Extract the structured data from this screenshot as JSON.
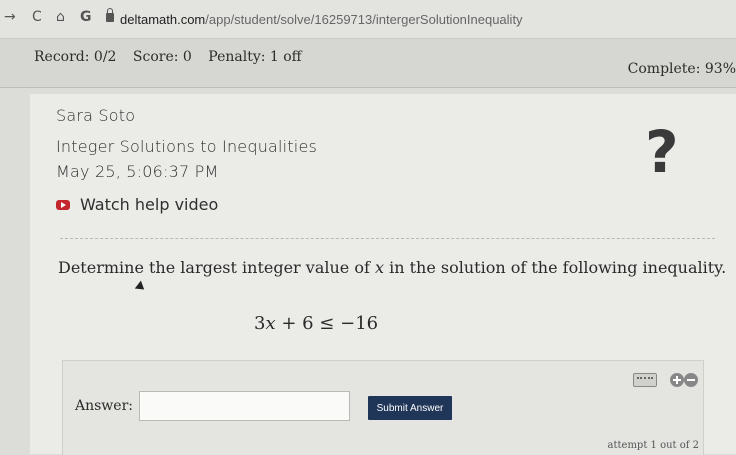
{
  "browser": {
    "url_host": "deltamath.com",
    "url_path": "/app/student/solve/16259713/intergerSolutionInequality"
  },
  "record_bar": {
    "record": "Record: 0/2",
    "score": "Score: 0",
    "penalty": "Penalty: 1 off",
    "complete": "Complete: 93%"
  },
  "header": {
    "student_name": "Sara Soto",
    "assignment": "Integer Solutions to Inequalities",
    "timestamp": "May 25, 5:06:37 PM",
    "help_mark": "?",
    "video_link": "Watch help video"
  },
  "problem": {
    "prompt_start": "Determine the largest integer value of ",
    "prompt_var": "x",
    "prompt_end": " in the solution of the following inequality.",
    "eq_coef": "3",
    "eq_var": "x",
    "eq_rest": " + 6 ≤ −16"
  },
  "answer": {
    "label": "Answer:",
    "value": "",
    "submit_label": "Submit Answer",
    "attempt": "attempt 1 out of 2"
  },
  "icons": [
    "back-arrow-icon",
    "reload-icon",
    "home-icon",
    "google-icon",
    "lock-icon",
    "youtube-icon",
    "keyboard-icon",
    "plus-icon",
    "minus-icon"
  ]
}
